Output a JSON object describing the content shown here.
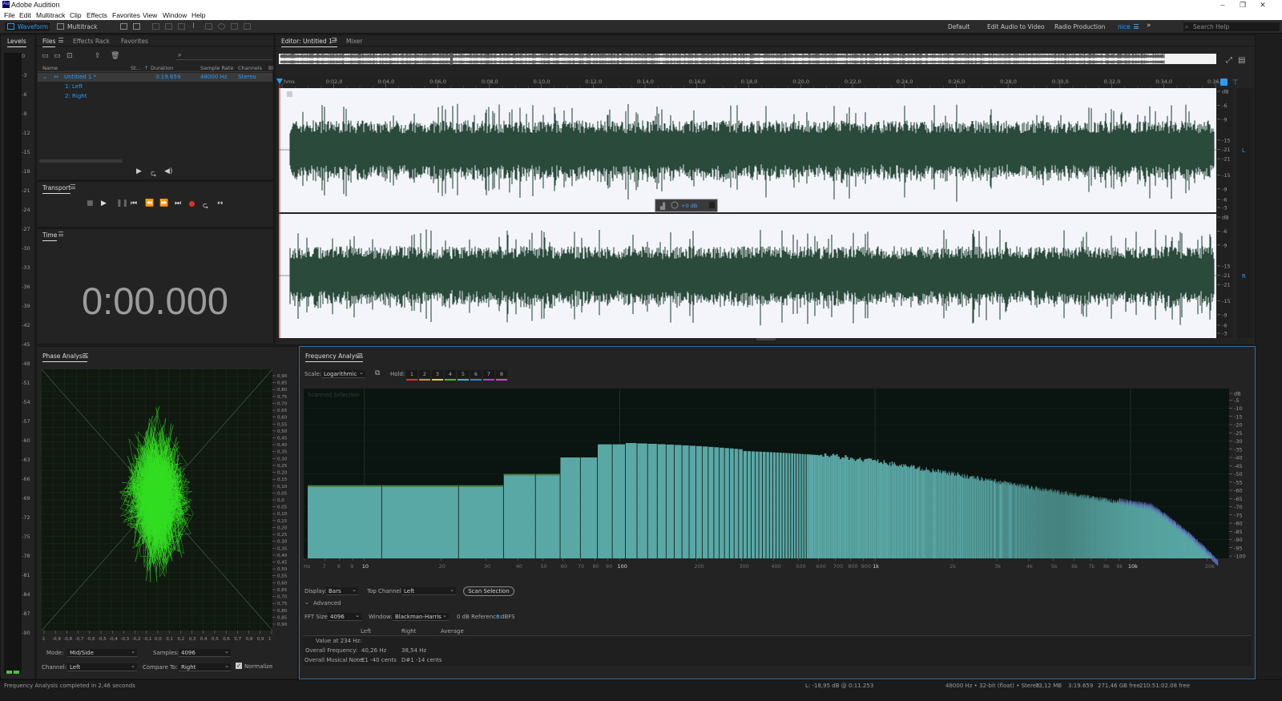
{
  "app": {
    "title": "Adobe Audition",
    "icon_text": "Au"
  },
  "menu": [
    "File",
    "Edit",
    "Multitrack",
    "Clip",
    "Effects",
    "Favorites",
    "View",
    "Window",
    "Help"
  ],
  "toolbar": {
    "waveform_label": "Waveform",
    "multitrack_label": "Multitrack",
    "workspaces": [
      "Default",
      "Edit Audio to Video",
      "Radio Production",
      "nice"
    ],
    "search_placeholder": "Search Help"
  },
  "levels": {
    "title": "Levels",
    "ticks": [
      "0",
      "-3",
      "-6",
      "-9",
      "-12",
      "-15",
      "-18",
      "-21",
      "-24",
      "-27",
      "-30",
      "-33",
      "-36",
      "-39",
      "-42",
      "-45",
      "-48",
      "-51",
      "-54",
      "-57",
      "-60",
      "-63",
      "-66",
      "-69",
      "-72",
      "-75",
      "-78",
      "-81",
      "-84",
      "-87",
      "-90"
    ],
    "unit": "dB"
  },
  "files": {
    "tabs": [
      "Files",
      "Effects Rack",
      "Favorites"
    ],
    "columns": [
      "Name",
      "St...",
      "Duration",
      "Sample Rate",
      "Channels",
      "Bi"
    ],
    "rows": [
      {
        "name": "Untitled 1 *",
        "duration": "3:19.659",
        "sample_rate": "48000 Hz",
        "channels": "Stereo"
      },
      {
        "name": "1: Left"
      },
      {
        "name": "2: Right"
      }
    ]
  },
  "transport": {
    "title": "Transport"
  },
  "time": {
    "title": "Time",
    "value": "0:00.000"
  },
  "editor": {
    "tabs": [
      "Editor: Untitled 1 *",
      "Mixer"
    ],
    "ruler": [
      "hms",
      "0:02,0",
      "0:04,0",
      "0:06,0",
      "0:08,0",
      "0:10,0",
      "0:12,0",
      "0:14,0",
      "0:16,0",
      "0:18,0",
      "0:20,0",
      "0:22,0",
      "0:24,0",
      "0:26,0",
      "0:28,0",
      "0:30,0",
      "0:32,0",
      "0:34,0",
      "0:36,0"
    ],
    "db_ticks_top": [
      "dB",
      "-6",
      "-9",
      "-15",
      "-21",
      "-21",
      "-15",
      "-9",
      "-6",
      "-3"
    ],
    "db_ticks_bottom": [
      "dB",
      "-6",
      "-9",
      "-15",
      "-21",
      "-21",
      "-15",
      "-9",
      "-6",
      "-3"
    ],
    "hud_value": "+0 dB",
    "channel_labels": [
      "L",
      "R"
    ]
  },
  "phase": {
    "title": "Phase Analysis",
    "right_ticks": [
      "0,90",
      "0,85",
      "0,80",
      "0,75",
      "0,70",
      "0,65",
      "0,60",
      "0,55",
      "0,50",
      "0,45",
      "0,40",
      "0,35",
      "0,30",
      "0,25",
      "0,20",
      "0,15",
      "0,10",
      "0,05",
      "0,0",
      "0,05",
      "0,10",
      "0,15",
      "0,20",
      "0,25",
      "0,30",
      "0,35",
      "0,40",
      "0,45",
      "0,50",
      "0,55",
      "0,60",
      "0,65",
      "0,70",
      "0,75",
      "0,80",
      "0,85",
      "0,90"
    ],
    "bottom_ticks": [
      "-1",
      "-0,9",
      "-0,8",
      "-0,7",
      "-0,6",
      "-0,5",
      "-0,4",
      "-0,3",
      "-0,2",
      "-0,1",
      "0,0",
      "0,1",
      "0,2",
      "0,3",
      "0,4",
      "0,5",
      "0,6",
      "0,7",
      "0,8",
      "0,9",
      "1"
    ],
    "mode_label": "Mode:",
    "mode_value": "Mid/Side",
    "samples_label": "Samples:",
    "samples_value": "4096",
    "channel_label": "Channel:",
    "channel_value": "Left",
    "compare_label": "Compare To:",
    "compare_value": "Right",
    "normalize_label": "Normalize"
  },
  "freq": {
    "title": "Frequency Analysis",
    "scale_label": "Scale:",
    "scale_value": "Logarithmic",
    "hold_label": "Hold:",
    "hold_buttons": [
      "1",
      "2",
      "3",
      "4",
      "5",
      "6",
      "7",
      "8"
    ],
    "hold_colors": [
      "#e03030",
      "#e08a20",
      "#e0d020",
      "#40c030",
      "#30c0c0",
      "#3080e0",
      "#a040e0",
      "#e040c0"
    ],
    "overlay": "Scanned Selection",
    "db_ticks": [
      "dB",
      "-5",
      "-10",
      "-15",
      "-20",
      "-25",
      "-30",
      "-35",
      "-40",
      "-45",
      "-50",
      "-55",
      "-60",
      "-65",
      "-70",
      "-75",
      "-80",
      "-85",
      "-90",
      "-95",
      "-100"
    ],
    "hz_ticks": [
      "Hz",
      "7",
      "8",
      "9",
      "10",
      "20",
      "30",
      "40",
      "50",
      "60",
      "70",
      "80",
      "90",
      "100",
      "200",
      "300",
      "400",
      "500",
      "600",
      "700",
      "800",
      "900",
      "1k",
      "2k",
      "3k",
      "4k",
      "5k",
      "6k",
      "7k",
      "8k",
      "9k",
      "10k",
      "20k"
    ],
    "display_label": "Display:",
    "display_value": "Bars",
    "topchannel_label": "Top Channel:",
    "topchannel_value": "Left",
    "scan_button": "Scan Selection",
    "advanced_label": "Advanced",
    "fft_label": "FFT Size:",
    "fft_value": "4096",
    "window_label": "Window:",
    "window_value": "Blackman-Harris",
    "ref_label": "0 dB Reference:",
    "ref_value": "0",
    "ref_unit": "dBFS",
    "table_cols": [
      "Left",
      "Right",
      "Average"
    ],
    "rows": [
      {
        "label": "Value at 234 Hz:",
        "left": "",
        "right": ""
      },
      {
        "label": "Overall Frequency:",
        "left": "40,26 Hz",
        "right": "38,54 Hz"
      },
      {
        "label": "Overall Musical Note:",
        "left": "E1 -40 cents",
        "right": "D#1 -14 cents"
      }
    ],
    "colors": {
      "bars": "#5aa8a6",
      "top_bars": "#4a8040",
      "tail": "#6070c0"
    }
  },
  "status": {
    "left": "Frequency Analysis completed in 2,46 seconds",
    "items": [
      "L: -18,95 dB @ 0:11.253",
      "48000 Hz • 32-bit (float) • Stereo",
      "73,12 MB",
      "3:19.659",
      "271,46 GB free",
      "210:51:02.08 free"
    ]
  }
}
